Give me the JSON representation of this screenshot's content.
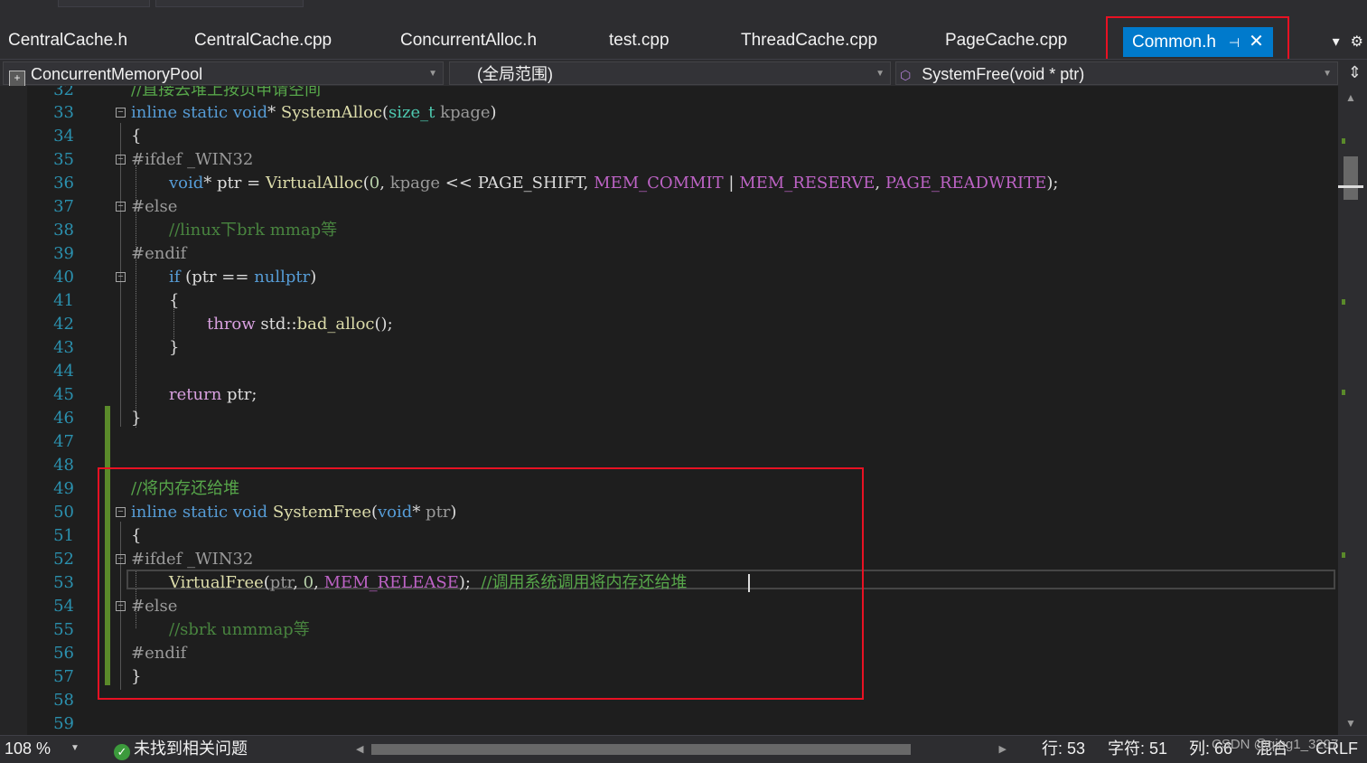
{
  "tabs": [
    {
      "label": "CentralCache.h"
    },
    {
      "label": "CentralCache.cpp"
    },
    {
      "label": "ConcurrentAlloc.h"
    },
    {
      "label": "test.cpp"
    },
    {
      "label": "ThreadCache.cpp"
    },
    {
      "label": "PageCache.cpp"
    },
    {
      "label": "Common.h",
      "active": true
    }
  ],
  "tab_icons": {
    "pin": "pin-icon",
    "close": "close-icon",
    "dropdown": "tab-dropdown-icon",
    "settings": "gear-icon"
  },
  "nav": {
    "project": "ConcurrentMemoryPool",
    "scope": "(全局范围)",
    "member": "SystemFree(void * ptr)"
  },
  "code": {
    "lines": [
      {
        "num": "32",
        "text": "//直接去堆上按页申请空间"
      },
      {
        "num": "33"
      },
      {
        "num": "34"
      },
      {
        "num": "35"
      },
      {
        "num": "36"
      },
      {
        "num": "37"
      },
      {
        "num": "38"
      },
      {
        "num": "39"
      },
      {
        "num": "40"
      },
      {
        "num": "41"
      },
      {
        "num": "42"
      },
      {
        "num": "43"
      },
      {
        "num": "44"
      },
      {
        "num": "45"
      },
      {
        "num": "46"
      },
      {
        "num": "47"
      },
      {
        "num": "48"
      },
      {
        "num": "49"
      },
      {
        "num": "50"
      },
      {
        "num": "51"
      },
      {
        "num": "52"
      },
      {
        "num": "53"
      },
      {
        "num": "54"
      },
      {
        "num": "55"
      },
      {
        "num": "56"
      },
      {
        "num": "57"
      },
      {
        "num": "58"
      },
      {
        "num": "59"
      }
    ],
    "t": {
      "inline": "inline",
      "static": "static",
      "void": "void",
      "star": "*",
      "SystemAlloc": "SystemAlloc",
      "size_t": "size_t",
      "kpage": "kpage",
      "lp": "(",
      "rp": ")",
      "lb": "{",
      "rb": "}",
      "ifdef": "#ifdef",
      "else": "#else",
      "endif": "#endif",
      "WIN32": "_WIN32",
      "ptr": "ptr",
      "eq": "=",
      "VirtualAlloc": "VirtualAlloc",
      "zero": "0",
      "comma": ",",
      "shl": "<<",
      "PAGE_SHIFT": "PAGE_SHIFT",
      "MEM_COMMIT": "MEM_COMMIT",
      "bar": "|",
      "MEM_RESERVE": "MEM_RESERVE",
      "PAGE_READWRITE": "PAGE_READWRITE",
      "semi": ";",
      "linux_comment": "//linux下brk mmap等",
      "if": "if",
      "eqeq": "==",
      "nullptr": "nullptr",
      "throw": "throw",
      "std": "std",
      "scope": "::",
      "bad_alloc": "bad_alloc",
      "parens": "()",
      "return": "return",
      "free_comment": "//将内存还给堆",
      "SystemFree": "SystemFree",
      "VirtualFree": "VirtualFree",
      "MEM_RELEASE": "MEM_RELEASE",
      "syscall_comment": "//调用系统调用将内存还给堆",
      "sbrk_comment": "//sbrk unmmap等"
    }
  },
  "status": {
    "zoom": "108 %",
    "issues": "未找到相关问题",
    "row": "行: 53",
    "char": "字符: 51",
    "col": "列: 66",
    "mixed": "混合",
    "eol": "CRLF",
    "watermark": "CSDN @qing1_3207"
  },
  "colors": {
    "accent": "#007acc",
    "highlight_box": "#e81123",
    "keyword": "#569cd6",
    "comment": "#57a64a",
    "macro": "#bd63c5",
    "function": "#dcdcaa",
    "line_number": "#2b91af",
    "change_bar": "#5a8a2a"
  }
}
